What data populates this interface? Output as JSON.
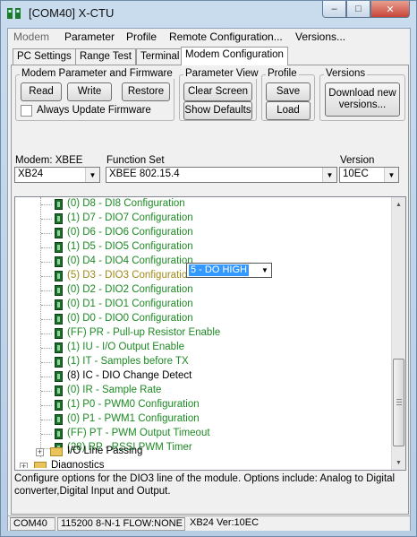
{
  "window": {
    "title": "[COM40] X-CTU"
  },
  "menu": [
    "Modem",
    "Parameter",
    "Profile",
    "Remote Configuration...",
    "Versions..."
  ],
  "tabs": [
    "PC Settings",
    "Range Test",
    "Terminal",
    "Modem Configuration"
  ],
  "groups": {
    "modem_param": {
      "label": "Modem Parameter and Firmware",
      "read": "Read",
      "write": "Write",
      "restore": "Restore",
      "always_update": "Always Update Firmware"
    },
    "param_view": {
      "label": "Parameter View",
      "clear": "Clear Screen",
      "defaults": "Show Defaults"
    },
    "profile": {
      "label": "Profile",
      "save": "Save",
      "load": "Load"
    },
    "versions": {
      "label": "Versions",
      "download": "Download new versions..."
    }
  },
  "selectors": {
    "modem_label": "Modem: XBEE",
    "modem_value": "XB24",
    "function_label": "Function Set",
    "function_value": "XBEE 802.15.4",
    "version_label": "Version",
    "version_value": "10EC"
  },
  "tree": {
    "rows": [
      {
        "text": "(0) D8 - DI8 Configuration",
        "color": "green"
      },
      {
        "text": "(1) D7 - DIO7 Configuration",
        "color": "green"
      },
      {
        "text": "(0) D6 - DIO6 Configuration",
        "color": "green"
      },
      {
        "text": "(1) D5 - DIO5 Configuration",
        "color": "green"
      },
      {
        "text": "(0) D4 - DIO4 Configuration",
        "color": "green"
      },
      {
        "text": "(5) D3 - DIO3 Configuration",
        "color": "olive"
      },
      {
        "text": "(0) D2 - DIO2 Configuration",
        "color": "green"
      },
      {
        "text": "(0) D1 - DIO1 Configuration",
        "color": "green"
      },
      {
        "text": "(0) D0 - DIO0 Configuration",
        "color": "green"
      },
      {
        "text": "(FF) PR - Pull-up Resistor Enable",
        "color": "green"
      },
      {
        "text": "(1) IU - I/O Output Enable",
        "color": "green"
      },
      {
        "text": "(1) IT - Samples before TX",
        "color": "green"
      },
      {
        "text": "(8) IC - DIO Change Detect",
        "color": "black"
      },
      {
        "text": "(0) IR - Sample Rate",
        "color": "green"
      },
      {
        "text": "(1) P0 - PWM0 Configuration",
        "color": "green"
      },
      {
        "text": "(0) P1 - PWM1 Configuration",
        "color": "green"
      },
      {
        "text": "(FF) PT - PWM Output Timeout",
        "color": "green"
      },
      {
        "text": "(28) RP - RSSI PWM Timer",
        "color": "green"
      }
    ],
    "folders": [
      "I/O Line Passing",
      "Diagnostics"
    ],
    "inline_value": "5 - DO HIGH"
  },
  "description": "Configure options for the DIO3 line of the module. Options include: Analog to Digital converter,Digital Input and Output.",
  "status": [
    "COM40",
    "115200 8-N-1  FLOW:NONE",
    "XB24  Ver:10EC"
  ],
  "colors": {
    "green": "#1d8a24",
    "olive": "#a08a1a",
    "black": "#000000"
  }
}
